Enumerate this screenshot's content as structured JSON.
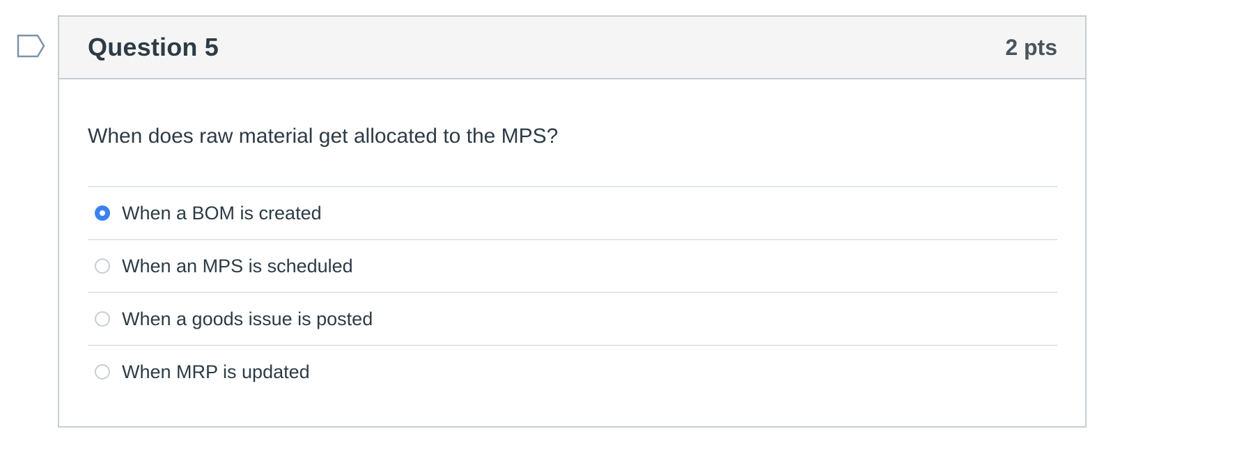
{
  "question": {
    "title": "Question 5",
    "points": "2 pts",
    "text": "When does raw material get allocated to the MPS?",
    "answers": [
      {
        "label": "When a BOM is created",
        "selected": true
      },
      {
        "label": "When an MPS is scheduled",
        "selected": false
      },
      {
        "label": "When a goods issue is posted",
        "selected": false
      },
      {
        "label": "When MRP is updated",
        "selected": false
      }
    ]
  },
  "colors": {
    "accent": "#3b82f0",
    "header_bg": "#f5f5f5",
    "border": "#c7cdd1",
    "text": "#2d3b45"
  },
  "icons": {
    "flag": "flag-question-icon",
    "radio_checked": "radio-checked-icon",
    "radio_unchecked": "radio-unchecked-icon"
  }
}
